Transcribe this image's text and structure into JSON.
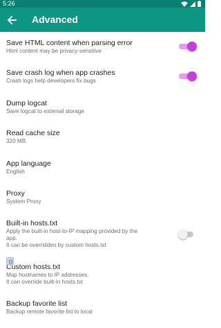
{
  "status_bar": {
    "time": "5:26"
  },
  "app_bar": {
    "title": "Advanced"
  },
  "settings": [
    {
      "title": "Save HTML content when parsing error",
      "summary": [
        "Html content may be privacy-sensitive"
      ],
      "switch": true
    },
    {
      "title": "Save crash log when app crashes",
      "summary": [
        "Crash logs help developers fix bugs"
      ],
      "switch": true
    },
    {
      "title": "Dump logcat",
      "summary": [
        "Save logcat to external storage"
      ]
    },
    {
      "title": "Read cache size",
      "summary": [
        "320 MB"
      ]
    },
    {
      "title": "App language",
      "summary": [
        "English"
      ]
    },
    {
      "title": "Proxy",
      "summary": [
        "System Proxy"
      ]
    },
    {
      "title": "Built-in hosts.txt",
      "summary": [
        "Apply the built-in host-to-IP mapping provided by the",
        "app.",
        "It can be overridden by custom hosts.txt"
      ],
      "switch": false
    },
    {
      "title": "Custom hosts.txt",
      "summary": [
        "Map hostnames to IP addresses.",
        "It can override built-in hosts.txt"
      ]
    },
    {
      "title": "Backup favorite list",
      "summary": [
        "Backup remote favorite list to local"
      ]
    }
  ]
}
